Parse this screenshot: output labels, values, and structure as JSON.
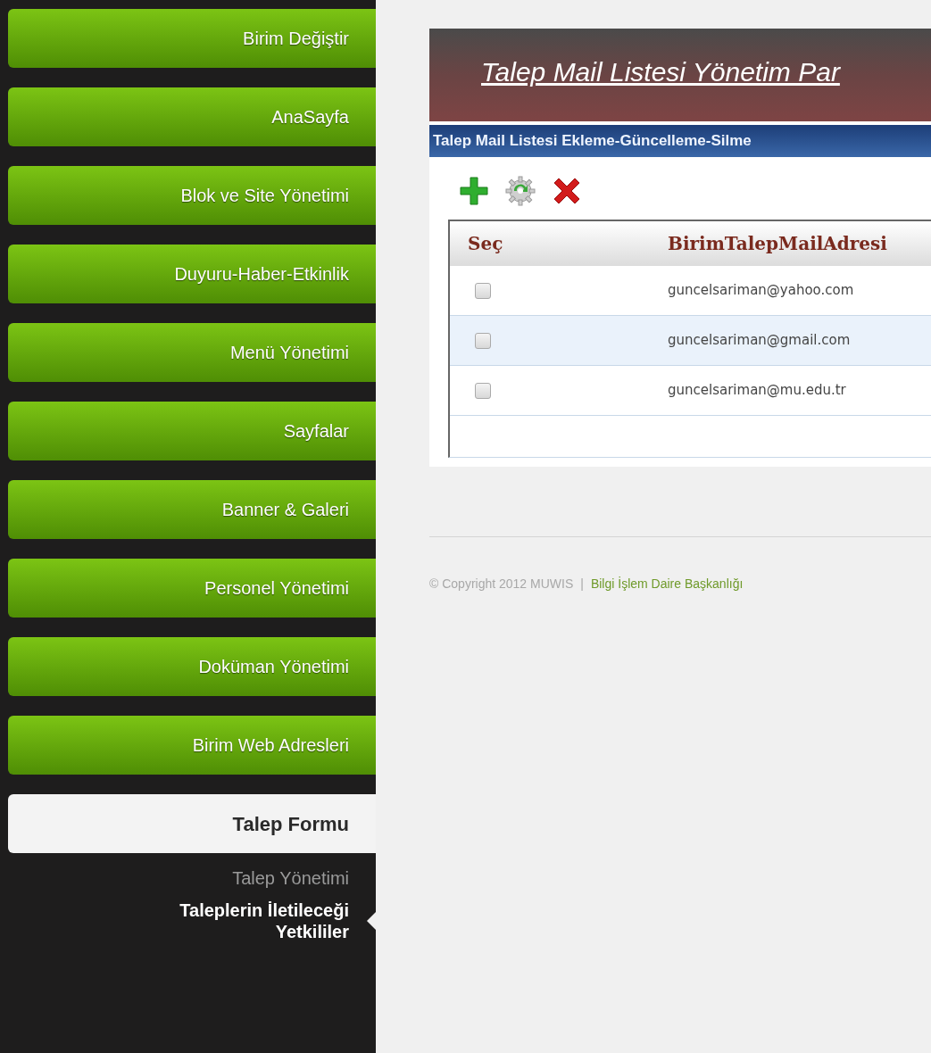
{
  "sidebar": {
    "items": [
      {
        "label": "Birim Değiştir",
        "selected": false
      },
      {
        "label": "AnaSayfa",
        "selected": false
      },
      {
        "label": "Blok ve Site Yönetimi",
        "selected": false
      },
      {
        "label": "Duyuru-Haber-Etkinlik",
        "selected": false
      },
      {
        "label": "Menü Yönetimi",
        "selected": false
      },
      {
        "label": "Sayfalar",
        "selected": false
      },
      {
        "label": "Banner & Galeri",
        "selected": false
      },
      {
        "label": "Personel Yönetimi",
        "selected": false
      },
      {
        "label": "Doküman Yönetimi",
        "selected": false
      },
      {
        "label": "Birim Web Adresleri",
        "selected": false
      },
      {
        "label": "Talep Formu",
        "selected": true,
        "children": [
          {
            "label": "Talep Yönetimi",
            "selected": false
          },
          {
            "label": "Taleplerin İletileceği Yetkililer",
            "selected": true
          }
        ]
      }
    ]
  },
  "panel": {
    "title": "Talep Mail Listesi Yönetim Par",
    "section_title": "Talep Mail Listesi Ekleme-Güncelleme-Silme",
    "toolbar": [
      {
        "kind": "add"
      },
      {
        "kind": "update"
      },
      {
        "kind": "delete"
      }
    ],
    "table": {
      "columns": [
        "Seç",
        "BirimTalepMailAdresi"
      ],
      "rows": [
        {
          "checked": false,
          "highlighted": false,
          "email": "guncelsariman@yahoo.com"
        },
        {
          "checked": false,
          "highlighted": true,
          "email": "guncelsariman@gmail.com"
        },
        {
          "checked": false,
          "highlighted": false,
          "email": "guncelsariman@mu.edu.tr"
        }
      ]
    }
  },
  "footer": {
    "copyright": "© Copyright 2012 MUWIS",
    "separator": "|",
    "link": "Bilgi İşlem Daire Başkanlığı"
  }
}
